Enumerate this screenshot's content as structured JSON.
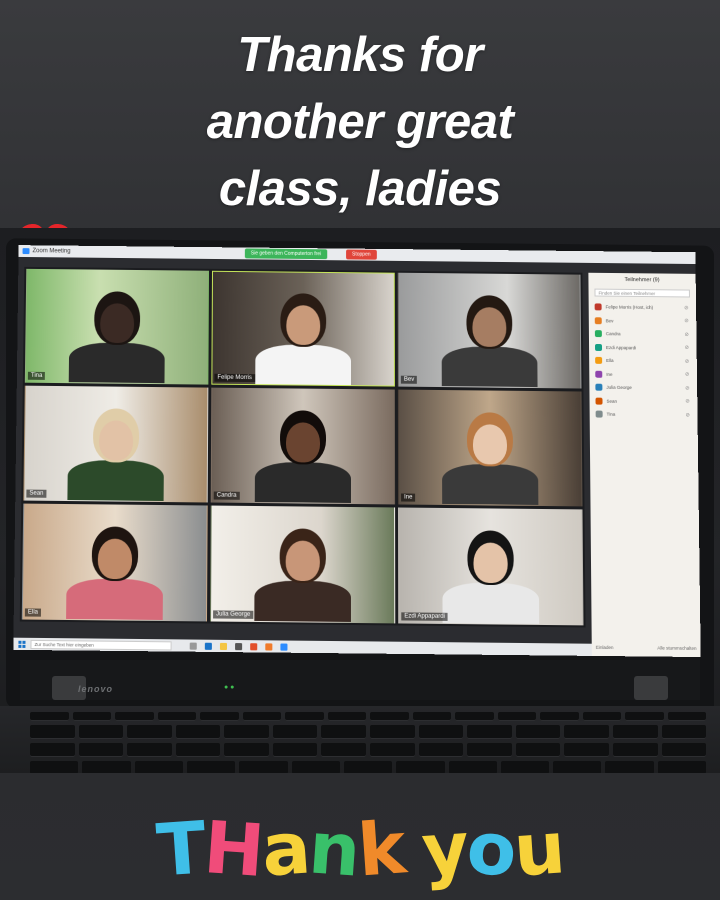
{
  "caption": {
    "line1": "Thanks for",
    "line2": "another great",
    "line3": "class, ladies",
    "emoji": "red-heart"
  },
  "zoom": {
    "window_title": "Zoom Meeting",
    "share_banner": "Sie geben den Computerton frei",
    "stop_label": "Stoppen",
    "participants_title": "Teilnehmer (9)",
    "search_placeholder": "Finden Sie einen Teilnehmer",
    "footer_left": "Einladen",
    "footer_right": "Alle stummschalten",
    "taskbar_search": "Zur Suche Text hier eingeben",
    "tiles": [
      {
        "name": "Tina",
        "active": false
      },
      {
        "name": "Felipe Morris",
        "active": true
      },
      {
        "name": "Bev",
        "active": false
      },
      {
        "name": "Sean",
        "active": false
      },
      {
        "name": "Candra",
        "active": false
      },
      {
        "name": "Ine",
        "active": false
      },
      {
        "name": "Ella",
        "active": false
      },
      {
        "name": "Julia George",
        "active": false
      },
      {
        "name": "Ezdi Appapardi",
        "active": false
      }
    ],
    "participants": [
      {
        "initial": "FM",
        "name": "Felipe Morris (Host, ich)",
        "color": "#c0392b"
      },
      {
        "initial": "B",
        "name": "Bev",
        "color": "#e67e22"
      },
      {
        "initial": "C",
        "name": "Candra",
        "color": "#27ae60"
      },
      {
        "initial": "EA",
        "name": "Ezdi Appapardi",
        "color": "#16a085"
      },
      {
        "initial": "E",
        "name": "Ella",
        "color": "#f39c12"
      },
      {
        "initial": "I",
        "name": "Ine",
        "color": "#8e44ad"
      },
      {
        "initial": "JG",
        "name": "Julia George",
        "color": "#2980b9"
      },
      {
        "initial": "S",
        "name": "Sean",
        "color": "#d35400"
      },
      {
        "initial": "T",
        "name": "Tina",
        "color": "#7f8c8d"
      }
    ]
  },
  "laptop": {
    "brand": "lenovo"
  },
  "sticker": {
    "letters": [
      "T",
      "H",
      "a",
      "n",
      "k",
      " ",
      "y",
      "o",
      "u"
    ],
    "colors": [
      "#3fbfe8",
      "#f04c7a",
      "#f7d23a",
      "#39c06a",
      "#f08a2a",
      "#ffffff",
      "#f7d23a",
      "#3fbfe8",
      "#f7d23a"
    ]
  }
}
